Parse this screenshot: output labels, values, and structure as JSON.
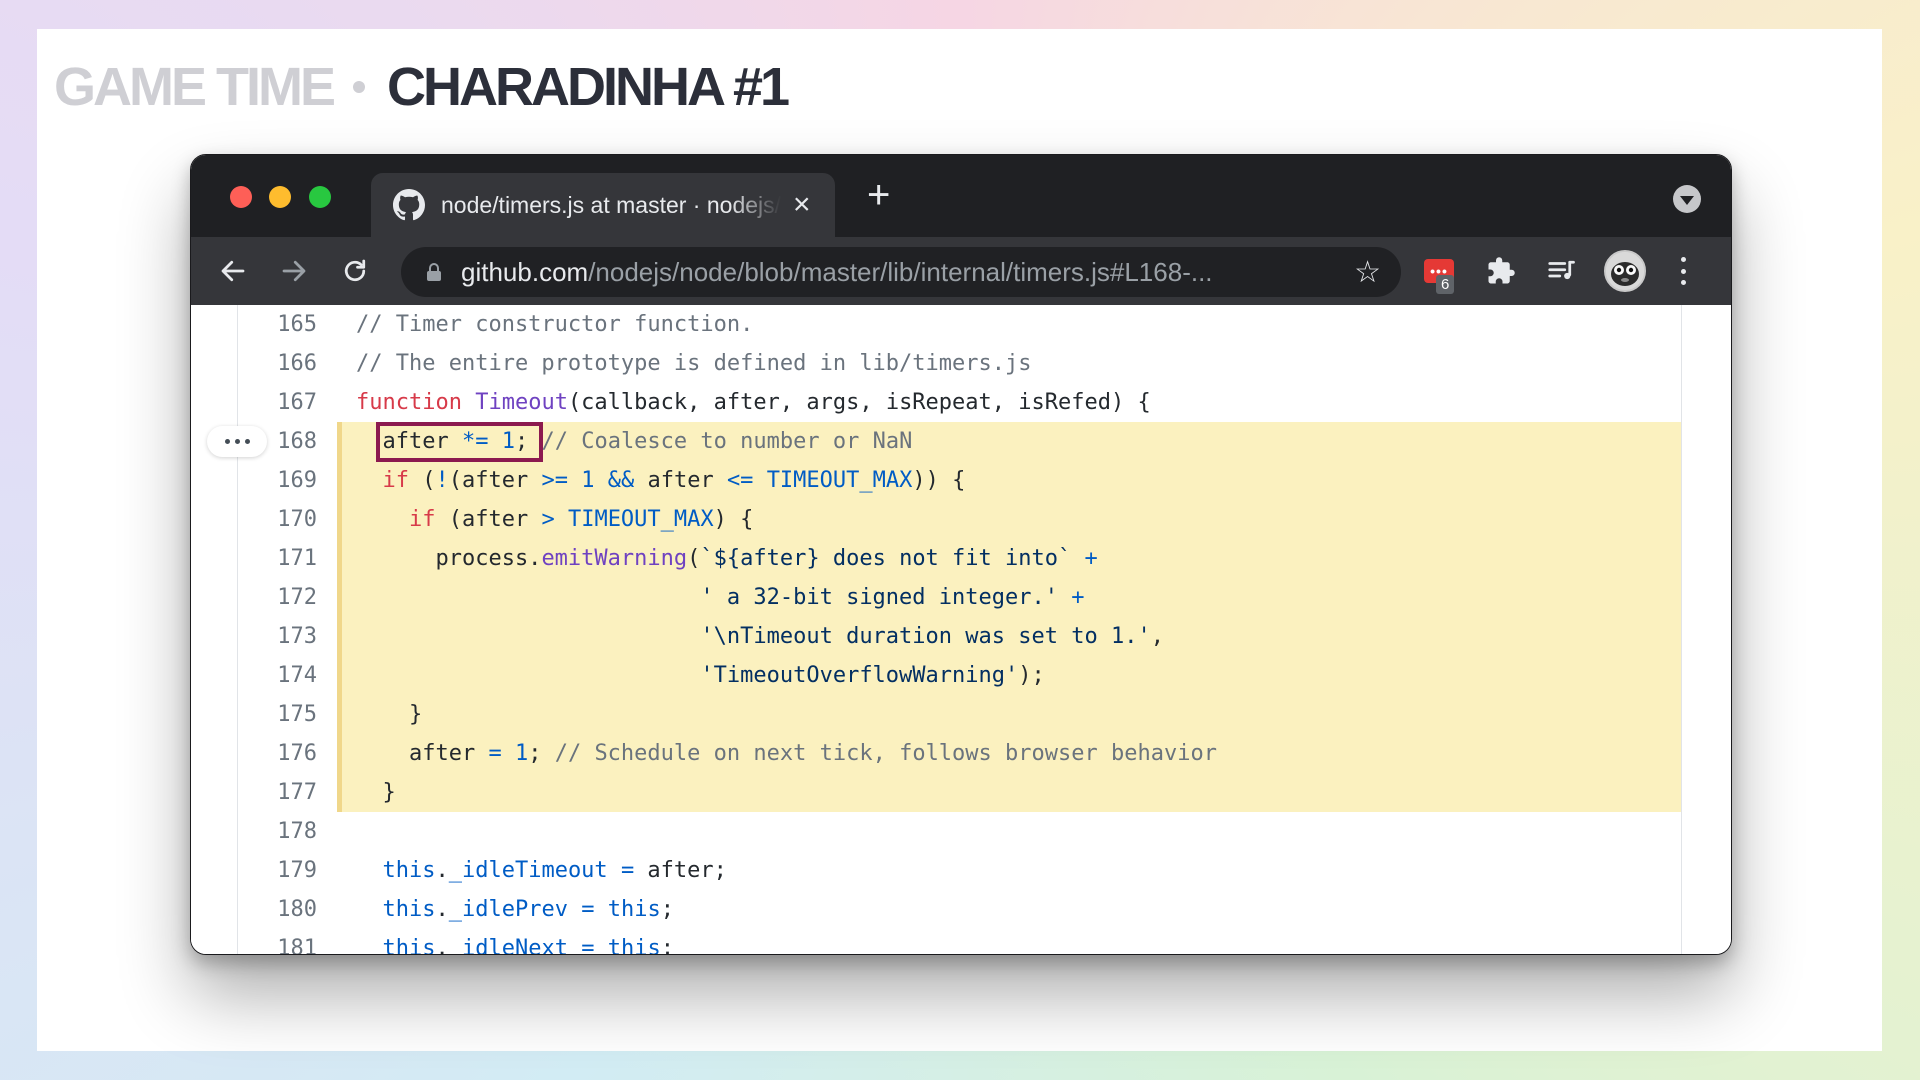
{
  "slide": {
    "title_prefix": "GAME TIME",
    "title_main": "CHARADINHA #1"
  },
  "browser": {
    "tab": {
      "title": "node/timers.js at master · nodejs/node",
      "icon": "github-icon"
    },
    "address": {
      "host": "github.com",
      "path": "/nodejs/node/blob/master/lib/internal/timers.js#L168-..."
    },
    "extensions": {
      "badge_count": "6",
      "red_ext_glyph": "•••"
    }
  },
  "code": {
    "highlighted_lines": "168-177",
    "annotation": "after *= 1;",
    "lines": [
      {
        "n": "165",
        "text": "// Timer constructor function."
      },
      {
        "n": "166",
        "text": "// The entire prototype is defined in lib/timers.js"
      },
      {
        "n": "167",
        "text": "function Timeout(callback, after, args, isRepeat, isRefed) {"
      },
      {
        "n": "168",
        "text": "  after *= 1; // Coalesce to number or NaN"
      },
      {
        "n": "169",
        "text": "  if (!(after >= 1 && after <= TIMEOUT_MAX)) {"
      },
      {
        "n": "170",
        "text": "    if (after > TIMEOUT_MAX) {"
      },
      {
        "n": "171",
        "text": "      process.emitWarning(`${after} does not fit into` +"
      },
      {
        "n": "172",
        "text": "                          ' a 32-bit signed integer.' +"
      },
      {
        "n": "173",
        "text": "                          '\\nTimeout duration was set to 1.',"
      },
      {
        "n": "174",
        "text": "                          'TimeoutOverflowWarning');"
      },
      {
        "n": "175",
        "text": "    }"
      },
      {
        "n": "176",
        "text": "    after = 1; // Schedule on next tick, follows browser behavior"
      },
      {
        "n": "177",
        "text": "  }"
      },
      {
        "n": "178",
        "text": ""
      },
      {
        "n": "179",
        "text": "  this._idleTimeout = after;"
      },
      {
        "n": "180",
        "text": "  this._idlePrev = this;"
      },
      {
        "n": "181",
        "text": "  this._idleNext = this;"
      }
    ]
  }
}
